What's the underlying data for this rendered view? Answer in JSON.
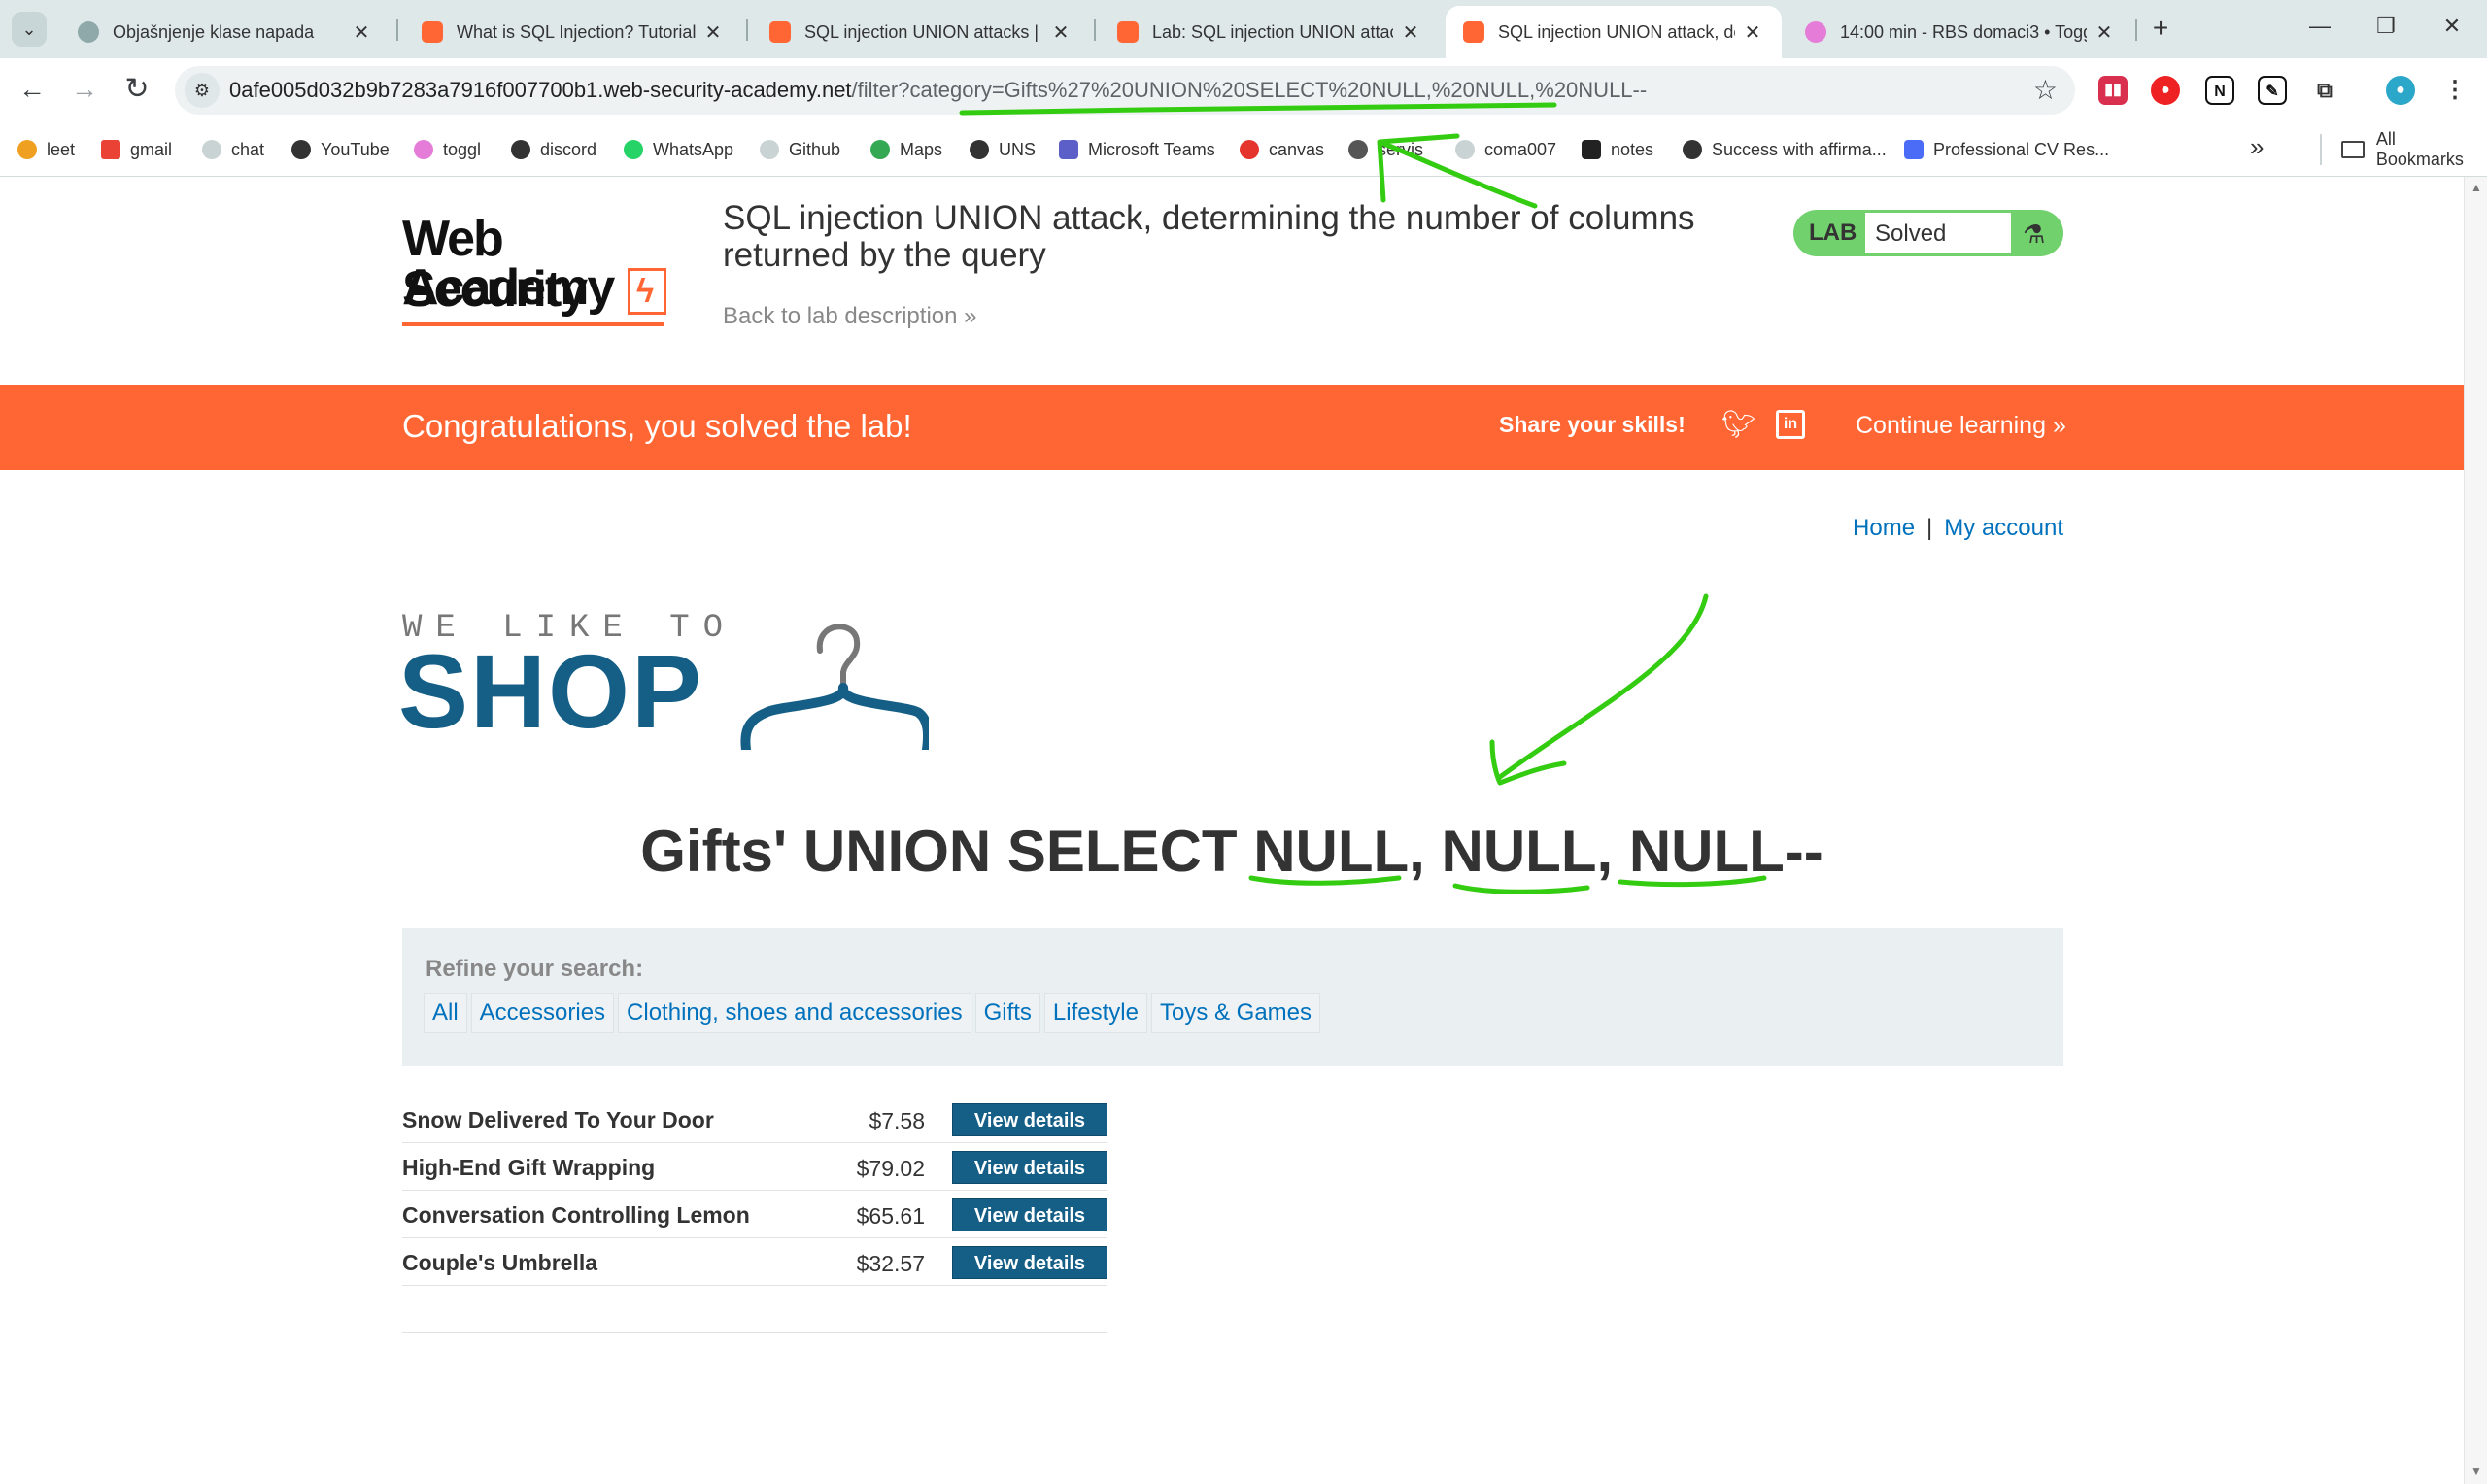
{
  "browser": {
    "tabs": [
      {
        "title": "Objašnjenje klase napada",
        "icon": "chatgpt-icon",
        "color": "#5b7d7e"
      },
      {
        "title": "What is SQL Injection? Tutorial",
        "icon": "portswigger-icon",
        "color": "#ff6633"
      },
      {
        "title": "SQL injection UNION attacks | W",
        "icon": "portswigger-icon",
        "color": "#ff6633"
      },
      {
        "title": "Lab: SQL injection UNION attac",
        "icon": "portswigger-icon",
        "color": "#ff6633"
      },
      {
        "title": "SQL injection UNION attack, de",
        "icon": "portswigger-icon",
        "color": "#ff6633",
        "active": true
      },
      {
        "title": "14:00 min - RBS domaci3 • Togg",
        "icon": "toggl-icon",
        "color": "#e57cd8"
      }
    ],
    "url_host": "0afe005d032b9b7283a7916f007700b1.web-security-academy.net",
    "url_path": "/filter?category=Gifts%27%20UNION%20SELECT%20NULL,%20NULL,%20NULL--",
    "bookmarks": [
      {
        "label": "leet",
        "color": "#f0a020"
      },
      {
        "label": "gmail",
        "color": "#ea4335"
      },
      {
        "label": "chat",
        "color": "#c9d3d4"
      },
      {
        "label": "YouTube",
        "color": "#333333"
      },
      {
        "label": "toggl",
        "color": "#e57cd8"
      },
      {
        "label": "discord",
        "color": "#333333"
      },
      {
        "label": "WhatsApp",
        "color": "#25d366"
      },
      {
        "label": "Github",
        "color": "#c9d3d4"
      },
      {
        "label": "Maps",
        "color": "#34a853"
      },
      {
        "label": "UNS",
        "color": "#333333"
      },
      {
        "label": "Microsoft Teams",
        "color": "#5b5fc7"
      },
      {
        "label": "canvas",
        "color": "#e4342c"
      },
      {
        "label": "servis",
        "color": "#555555"
      },
      {
        "label": "coma007",
        "color": "#c9d3d4"
      },
      {
        "label": "notes",
        "color": "#222222"
      },
      {
        "label": "Success with affirma...",
        "color": "#333333"
      },
      {
        "label": "Professional CV Res...",
        "color": "#4a6cf7"
      }
    ],
    "all_bookmarks": "All Bookmarks"
  },
  "header": {
    "logo_line1": "Web Security",
    "logo_line2": "Academy",
    "lab_title": "SQL injection UNION attack, determining the number of columns returned by the query",
    "back_link": "Back to lab description",
    "lab_label": "LAB",
    "lab_status": "Solved"
  },
  "banner": {
    "message": "Congratulations, you solved the lab!",
    "share": "Share your skills!",
    "continue": "Continue learning"
  },
  "nav": {
    "home": "Home",
    "separator": "|",
    "account": "My account"
  },
  "shop": {
    "tagline": "WE LIKE TO",
    "name": "SHOP"
  },
  "search_title": "Gifts' UNION SELECT NULL, NULL, NULL--",
  "refine": {
    "label": "Refine your search:",
    "filters": [
      "All",
      "Accessories",
      "Clothing, shoes and accessories",
      "Gifts",
      "Lifestyle",
      "Toys & Games"
    ]
  },
  "products": [
    {
      "name": "Snow Delivered To Your Door",
      "price": "$7.58",
      "button": "View details"
    },
    {
      "name": "High-End Gift Wrapping",
      "price": "$79.02",
      "button": "View details"
    },
    {
      "name": "Conversation Controlling Lemon",
      "price": "$65.61",
      "button": "View details"
    },
    {
      "name": "Couple's Umbrella",
      "price": "$32.57",
      "button": "View details"
    }
  ],
  "colors": {
    "accent_orange": "#ff6633",
    "shop_blue": "#155f87",
    "link_blue": "#0071bc",
    "lab_green": "#70d16d",
    "annotation_green": "#33cc11"
  }
}
